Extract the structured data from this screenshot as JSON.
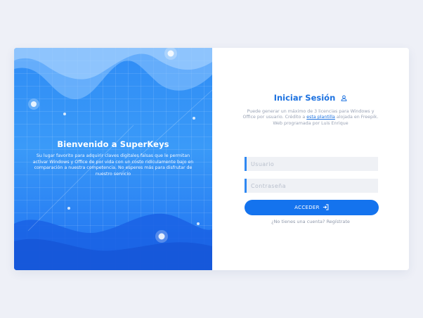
{
  "hero": {
    "title": "Bienvenido a SuperKeys",
    "description": "Su lugar favorito para adquirir claves digitales falsas que le permitan activar Windows y Office de por vida con un costo ridículamente bajo en comparación a nuestra competencia. No esperes más para disfrutar de nuestro servicio"
  },
  "login": {
    "title": "Iniciar Sesión",
    "info_before": "Puede generar un máximo de 3 licencias para Windows y Office por usuario. Crédito a ",
    "info_link": "esta plantilla",
    "info_after": " alojada en Freepik. Web programada por Luis Enrique",
    "username_placeholder": "Usuario",
    "password_placeholder": "Contraseña",
    "submit_label": "ACCEDER",
    "register_question": "¿No tienes una cuenta?",
    "register_link": "Regístrate"
  },
  "colors": {
    "accent": "#1473ee",
    "hero_gradient_top": "#2f8cf5",
    "hero_gradient_bottom": "#1e6ff0",
    "page_background": "#eef0f7"
  },
  "icons": {
    "title_icon": "user-icon",
    "button_icon": "login-arrow-icon"
  }
}
